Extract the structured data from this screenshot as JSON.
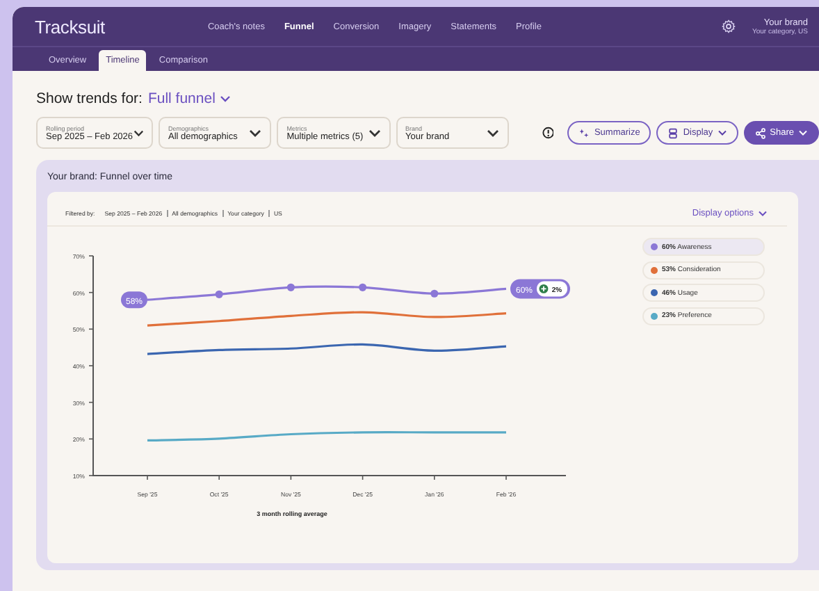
{
  "app": {
    "logo": "Tracksuit"
  },
  "nav": [
    {
      "label": "Coach's notes",
      "selected": false
    },
    {
      "label": "Funnel",
      "selected": true
    },
    {
      "label": "Conversion",
      "selected": false
    },
    {
      "label": "Imagery",
      "selected": false
    },
    {
      "label": "Statements",
      "selected": false
    },
    {
      "label": "Profile",
      "selected": false
    }
  ],
  "account": {
    "brand": "Your brand",
    "subtitle": "Your category, US"
  },
  "subtabs": [
    {
      "label": "Overview",
      "selected": false
    },
    {
      "label": "Timeline",
      "selected": true
    },
    {
      "label": "Comparison",
      "selected": false
    }
  ],
  "trend_selector": {
    "label": "Show trends for:",
    "value": "Full funnel"
  },
  "filters": [
    {
      "label": "Rolling period",
      "value": "Sep 2025 – Feb 2026"
    },
    {
      "label": "Demographics",
      "value": "All demographics"
    },
    {
      "label": "Metrics",
      "value": "Multiple metrics (5)"
    },
    {
      "label": "Brand",
      "value": "Your brand"
    }
  ],
  "actions": [
    {
      "kind": "summarize",
      "label": "Summarize"
    },
    {
      "kind": "display",
      "label": "Display"
    },
    {
      "kind": "share",
      "label": "Share"
    }
  ],
  "panel": {
    "title": "Your brand: Funnel over time",
    "filtered_by": {
      "label": "Filtered by:",
      "items": [
        "Sep 2025 – Feb 2026",
        "All demographics",
        "Your category",
        "US"
      ]
    },
    "display_options": "Display options",
    "chart_data": {
      "type": "line",
      "xlabel": "3 month rolling average",
      "categories": [
        "Sep '25",
        "Oct '25",
        "Nov '25",
        "Dec '25",
        "Jan '26",
        "Feb '26"
      ],
      "ylim": [
        10,
        70
      ],
      "yticks": [
        {
          "value": 10,
          "label": "10%"
        },
        {
          "value": 20,
          "label": "20%"
        },
        {
          "value": 30,
          "label": "30%"
        },
        {
          "value": 40,
          "label": "40%"
        },
        {
          "value": 50,
          "label": "50%"
        },
        {
          "value": 60,
          "label": "60%"
        },
        {
          "value": 70,
          "label": "70%"
        }
      ],
      "series": [
        {
          "name": "Awareness",
          "color": "#8b77d6",
          "values": [
            58,
            59.5,
            61.4,
            61.4,
            59.7,
            61
          ]
        },
        {
          "name": "Consideration",
          "color": "#e0703a",
          "values": [
            51,
            52.2,
            53.6,
            54.6,
            53.3,
            54.3
          ]
        },
        {
          "name": "Usage",
          "color": "#3b66b0",
          "values": [
            43.2,
            44.3,
            44.7,
            45.8,
            44.1,
            45.3
          ]
        },
        {
          "name": "Preference",
          "color": "#58aac6",
          "values": [
            19.6,
            20.1,
            21.3,
            21.8,
            21.8,
            21.8
          ]
        }
      ]
    },
    "callouts": {
      "start": "58%",
      "end": "60%",
      "change": "2%"
    },
    "legend": [
      {
        "value": "60%",
        "selected": true
      },
      {
        "value": "53%",
        "selected": false
      },
      {
        "value": "46%",
        "selected": false
      },
      {
        "value": "23%",
        "selected": false
      }
    ]
  }
}
